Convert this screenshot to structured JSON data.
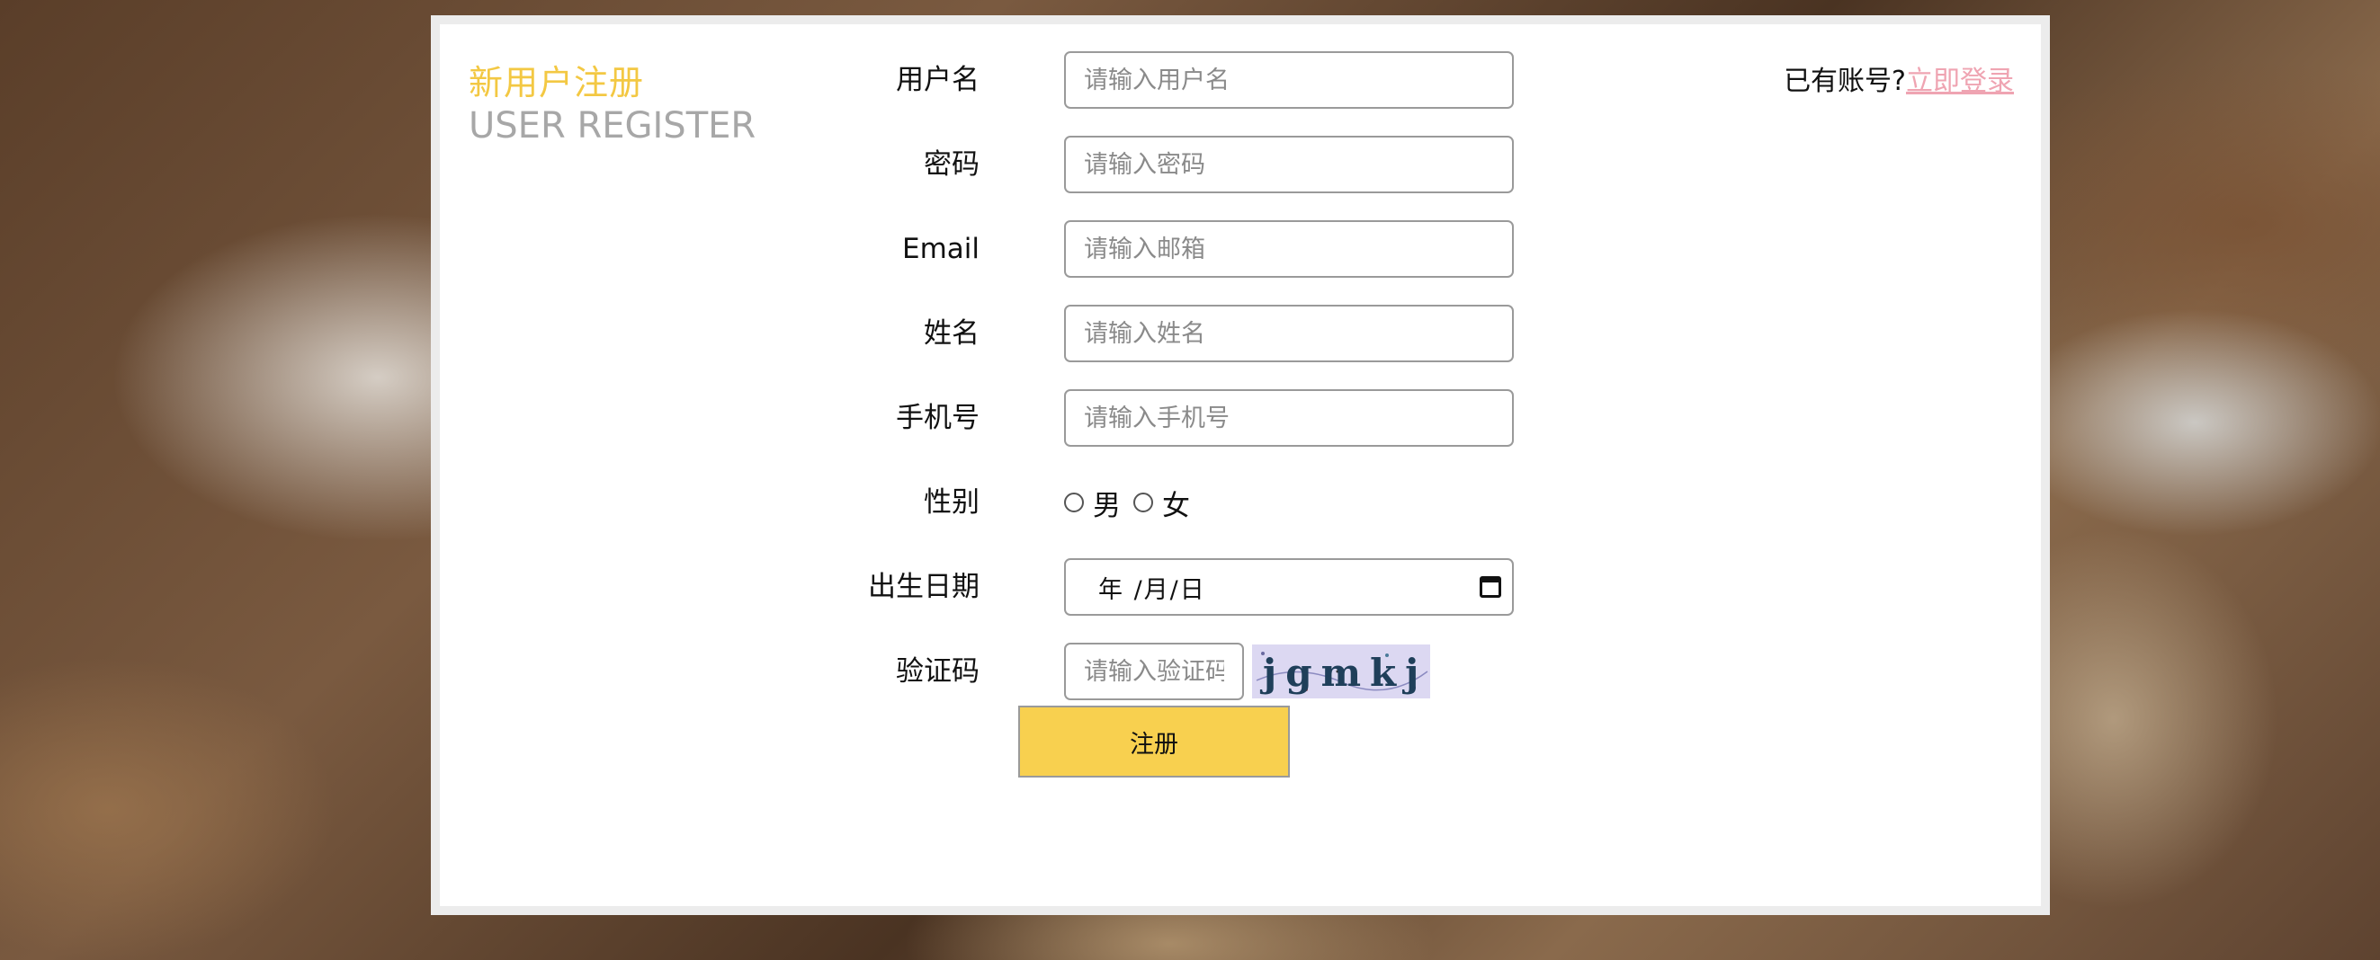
{
  "header": {
    "title_cn": "新用户注册",
    "title_en": "USER REGISTER"
  },
  "login": {
    "prompt": "已有账号?",
    "link": "立即登录"
  },
  "form": {
    "username": {
      "label": "用户名",
      "placeholder": "请输入用户名"
    },
    "password": {
      "label": "密码",
      "placeholder": "请输入密码"
    },
    "email": {
      "label": "Email",
      "placeholder": "请输入邮箱"
    },
    "name": {
      "label": "姓名",
      "placeholder": "请输入姓名"
    },
    "phone": {
      "label": "手机号",
      "placeholder": "请输入手机号"
    },
    "gender": {
      "label": "性别",
      "male": "男",
      "female": "女"
    },
    "birthday": {
      "label": "出生日期",
      "format": "年 /月/日"
    },
    "captcha": {
      "label": "验证码",
      "placeholder": "请输入验证码",
      "image_text": "jgmkj"
    },
    "submit": "注册"
  },
  "colors": {
    "title_accent": "#f3c843",
    "link": "#efa4b2",
    "button": "#f8d04f",
    "captcha_bg": "#dcd8f2"
  }
}
